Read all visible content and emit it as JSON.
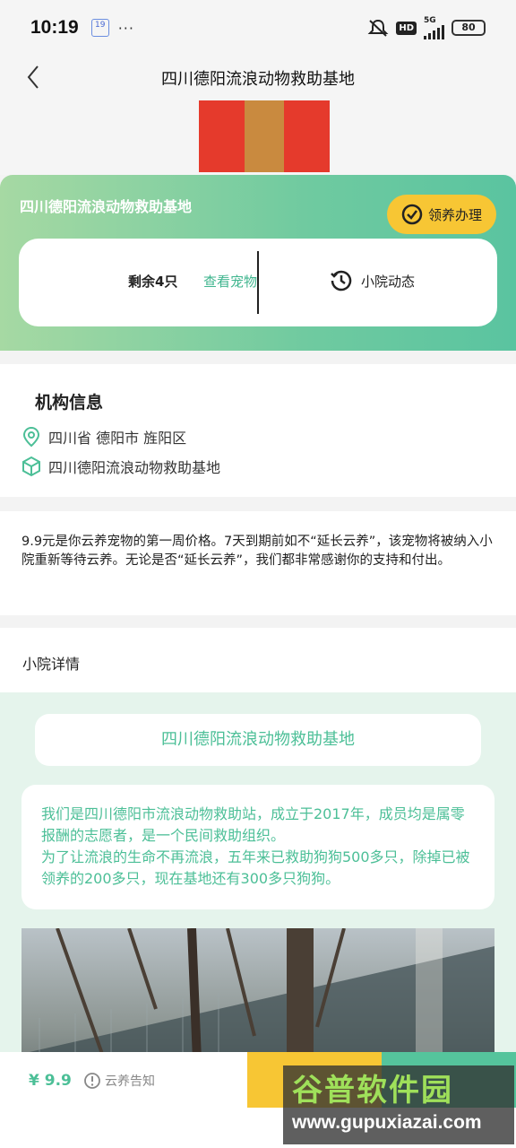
{
  "status_bar": {
    "time": "10:19",
    "calendar_day": "19",
    "more": "···",
    "hd_badge": "HD",
    "network": "5G",
    "battery": "80"
  },
  "nav": {
    "back_icon": "chevron-left-icon",
    "title": "四川德阳流浪动物救助基地"
  },
  "hero": {
    "org_name": "四川德阳流浪动物救助基地",
    "adopt_button": "领养办理",
    "remaining_label": "剩余4只",
    "view_pets_link": "查看宠物",
    "news_label": "小院动态"
  },
  "org_info": {
    "heading": "机构信息",
    "location": "四川省 德阳市 旌阳区",
    "base_name": "四川德阳流浪动物救助基地"
  },
  "notice": {
    "text": "9.9元是你云养宠物的第一周价格。7天到期前如不“延长云养”，该宠物将被纳入小院重新等待云养。无论是否“延长云养”，我们都非常感谢你的支持和付出。"
  },
  "details": {
    "heading": "小院详情",
    "name_card": "四川德阳流浪动物救助基地",
    "desc_line1": "我们是四川德阳市流浪动物救助站，成立于2017年，成员均是属零报酬的志愿者，是一个民间救助组织。",
    "desc_line2": "为了让流浪的生命不再流浪，五年来已救助狗狗500多只，除掉已被领养的200多只，现在基地还有300多只狗狗。"
  },
  "bottom": {
    "price": "¥ 9.9",
    "tip_label": "云养告知",
    "primary_button": "",
    "secondary_button": ""
  },
  "watermark": {
    "title": "谷普软件园",
    "url": "www.gupuxiazai.com"
  },
  "colors": {
    "accent_green": "#4cbf97",
    "button_yellow": "#f7c634",
    "gift_red": "#e53a2c"
  }
}
